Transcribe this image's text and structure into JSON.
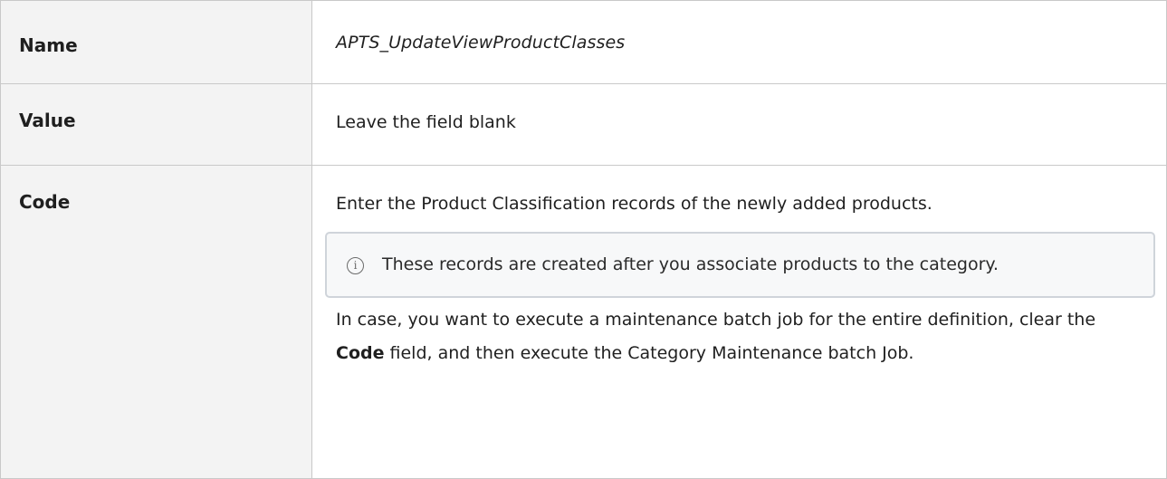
{
  "rows": {
    "name": {
      "label": "Name",
      "value": "APTS_UpdateViewProductClasses"
    },
    "value": {
      "label": "Value",
      "value": "Leave the field blank"
    },
    "code": {
      "label": "Code",
      "intro": "Enter the Product Classification records of the newly added products.",
      "info_icon": "info-icon",
      "note": "These records are created after you associate products to the category.",
      "outro_before": "In case, you want to execute a maintenance batch job for the entire definition, clear the ",
      "outro_bold": "Code",
      "outro_after": " field, and then execute the Category Maintenance batch Job."
    }
  }
}
